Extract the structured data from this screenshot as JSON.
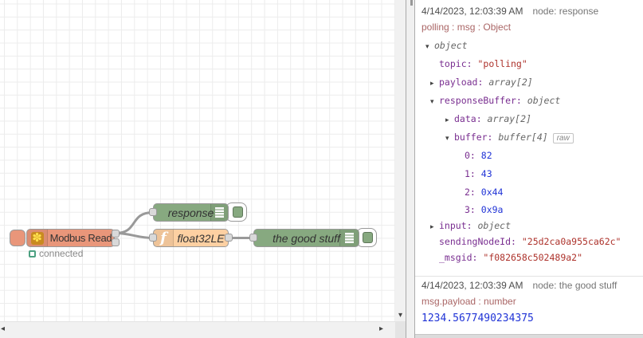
{
  "flow": {
    "nodes": {
      "modbus": {
        "label": "Modbus Read",
        "color": "#E9967A",
        "status": "connected",
        "status_color": "#4CA081"
      },
      "debug_response": {
        "label": "response",
        "color": "#87A980"
      },
      "function_float": {
        "label": "float32LE",
        "icon": "f",
        "color": "#FDD0A2"
      },
      "debug_good": {
        "label": "the good stuff",
        "color": "#87A980"
      }
    }
  },
  "debug_panel": {
    "messages": [
      {
        "timestamp": "4/14/2023, 12:03:39 AM",
        "source": "node: response",
        "meta": "polling : msg : Object",
        "tree": [
          {
            "level": 0,
            "arrow": "expanded",
            "type_label": "object"
          },
          {
            "level": 1,
            "key": "topic",
            "value": "\"polling\"",
            "vtype": "string"
          },
          {
            "level": 1,
            "arrow": "collapsed",
            "key": "payload",
            "type_label": "array[2]"
          },
          {
            "level": 1,
            "arrow": "expanded",
            "key": "responseBuffer",
            "type_label": "object"
          },
          {
            "level": 2,
            "arrow": "collapsed",
            "key": "data",
            "type_label": "array[2]"
          },
          {
            "level": 2,
            "arrow": "expanded",
            "key": "buffer",
            "type_label": "buffer[4]",
            "badge": "raw"
          },
          {
            "level": 3,
            "key": "0",
            "value": "82",
            "vtype": "number"
          },
          {
            "level": 3,
            "key": "1",
            "value": "43",
            "vtype": "number"
          },
          {
            "level": 3,
            "key": "2",
            "value": "0x44",
            "vtype": "number"
          },
          {
            "level": 3,
            "key": "3",
            "value": "0x9a",
            "vtype": "number"
          },
          {
            "level": 1,
            "arrow": "collapsed",
            "key": "input",
            "type_label": "object"
          },
          {
            "level": 1,
            "key": "sendingNodeId",
            "value": "\"25d2ca0a955ca62c\"",
            "vtype": "string"
          },
          {
            "level": 1,
            "key": "_msgid",
            "value": "\"f082658c502489a2\"",
            "vtype": "string"
          }
        ]
      },
      {
        "timestamp": "4/14/2023, 12:03:39 AM",
        "source": "node: the good stuff",
        "meta": "msg.payload : number",
        "payload": "1234.5677490234375"
      }
    ]
  }
}
